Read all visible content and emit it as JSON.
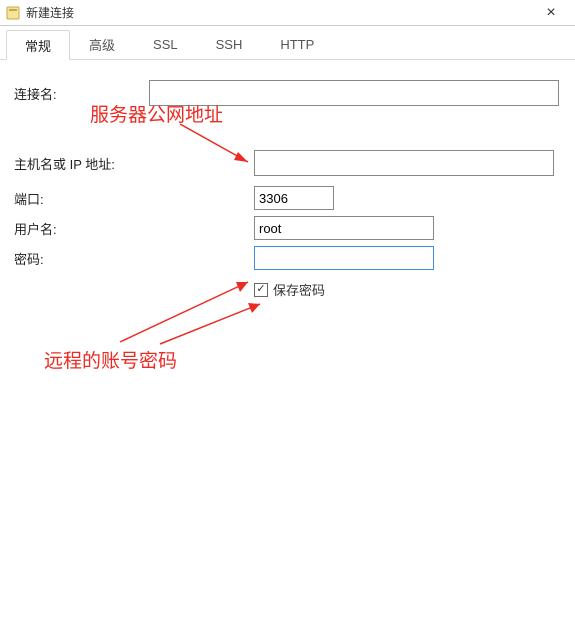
{
  "window": {
    "title": "新建连接",
    "close_glyph": "×"
  },
  "tabs": [
    {
      "label": "常规",
      "active": true
    },
    {
      "label": "高级",
      "active": false
    },
    {
      "label": "SSL",
      "active": false
    },
    {
      "label": "SSH",
      "active": false
    },
    {
      "label": "HTTP",
      "active": false
    }
  ],
  "form": {
    "connection_name_label": "连接名:",
    "connection_name_value": "",
    "host_label": "主机名或 IP 地址:",
    "host_value": "",
    "port_label": "端口:",
    "port_value": "3306",
    "user_label": "用户名:",
    "user_value": "root",
    "password_label": "密码:",
    "password_value": "",
    "save_password_label": "保存密码",
    "save_password_checked": true
  },
  "annotations": {
    "host_hint": "服务器公网地址",
    "password_hint": "远程的账号密码"
  },
  "colors": {
    "annotation_red": "#ec2b23",
    "focus_border": "#3a8fd8"
  },
  "checkmark_glyph": "✓"
}
